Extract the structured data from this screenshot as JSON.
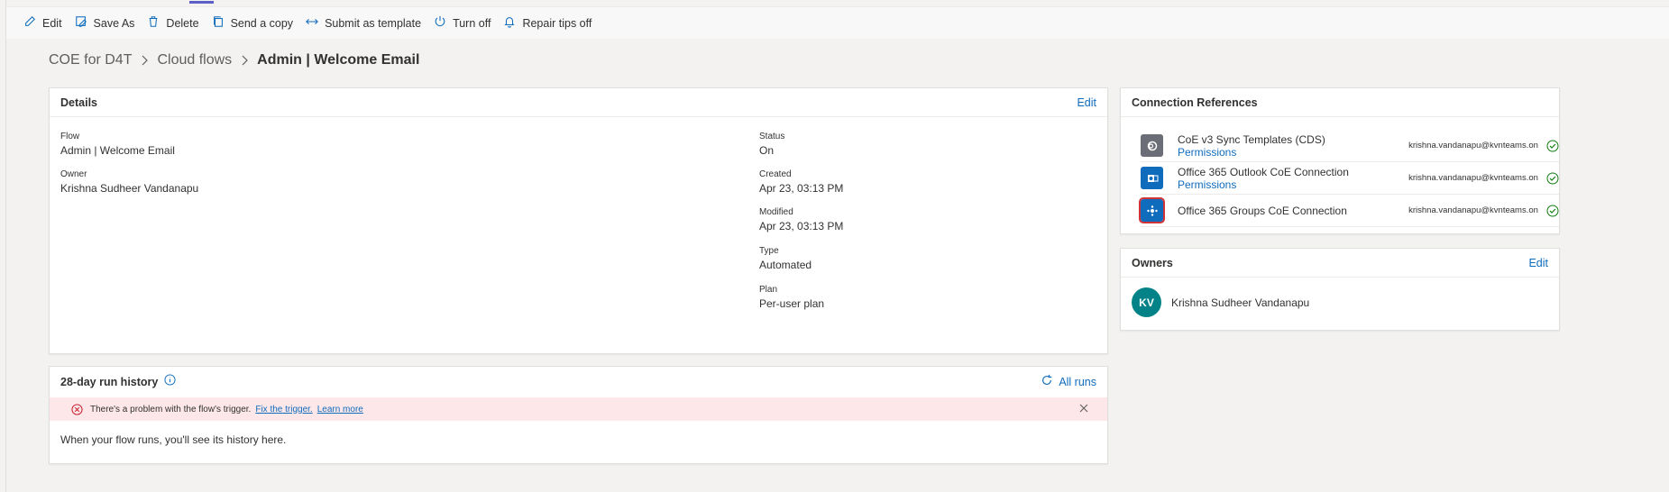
{
  "toolbar": {
    "edit": "Edit",
    "save_as": "Save As",
    "delete": "Delete",
    "send_copy": "Send a copy",
    "submit_template": "Submit as template",
    "turn_off": "Turn off",
    "repair_tips": "Repair tips off"
  },
  "breadcrumb": {
    "root": "COE for D4T",
    "section": "Cloud flows",
    "current": "Admin | Welcome Email"
  },
  "details": {
    "title": "Details",
    "edit": "Edit",
    "flow_label": "Flow",
    "flow_value": "Admin | Welcome Email",
    "owner_label": "Owner",
    "owner_value": "Krishna Sudheer Vandanapu",
    "status_label": "Status",
    "status_value": "On",
    "created_label": "Created",
    "created_value": "Apr 23, 03:13 PM",
    "modified_label": "Modified",
    "modified_value": "Apr 23, 03:13 PM",
    "type_label": "Type",
    "type_value": "Automated",
    "plan_label": "Plan",
    "plan_value": "Per-user plan"
  },
  "run_history": {
    "title": "28-day run history",
    "all_runs": "All runs",
    "error_text": "There's a problem with the flow's trigger.",
    "fix_link": "Fix the trigger.",
    "learn_link": "Learn more",
    "empty_text": "When your flow runs, you'll see its history here."
  },
  "connections": {
    "title": "Connection References",
    "items": [
      {
        "name": "CoE v3 Sync Templates (CDS)",
        "permissions": "Permissions",
        "email": "krishna.vandanapu@kvnteams.on",
        "icon": "dataverse-icon",
        "color": "#6b6e76"
      },
      {
        "name": "Office 365 Outlook CoE Connection",
        "permissions": "Permissions",
        "email": "krishna.vandanapu@kvnteams.on",
        "icon": "outlook-icon",
        "color": "#0f6cbd"
      },
      {
        "name": "Office 365 Groups CoE Connection",
        "permissions": "",
        "email": "krishna.vandanapu@kvnteams.on",
        "icon": "groups-icon",
        "color": "#0f6cbd"
      }
    ]
  },
  "owners": {
    "title": "Owners",
    "edit": "Edit",
    "initials": "KV",
    "name": "Krishna Sudheer Vandanapu",
    "avatar_color": "#038387"
  },
  "colors": {
    "accent": "#0f6cbd",
    "error_bg": "#fde7e9",
    "success": "#107c10",
    "error": "#c50f1f"
  }
}
